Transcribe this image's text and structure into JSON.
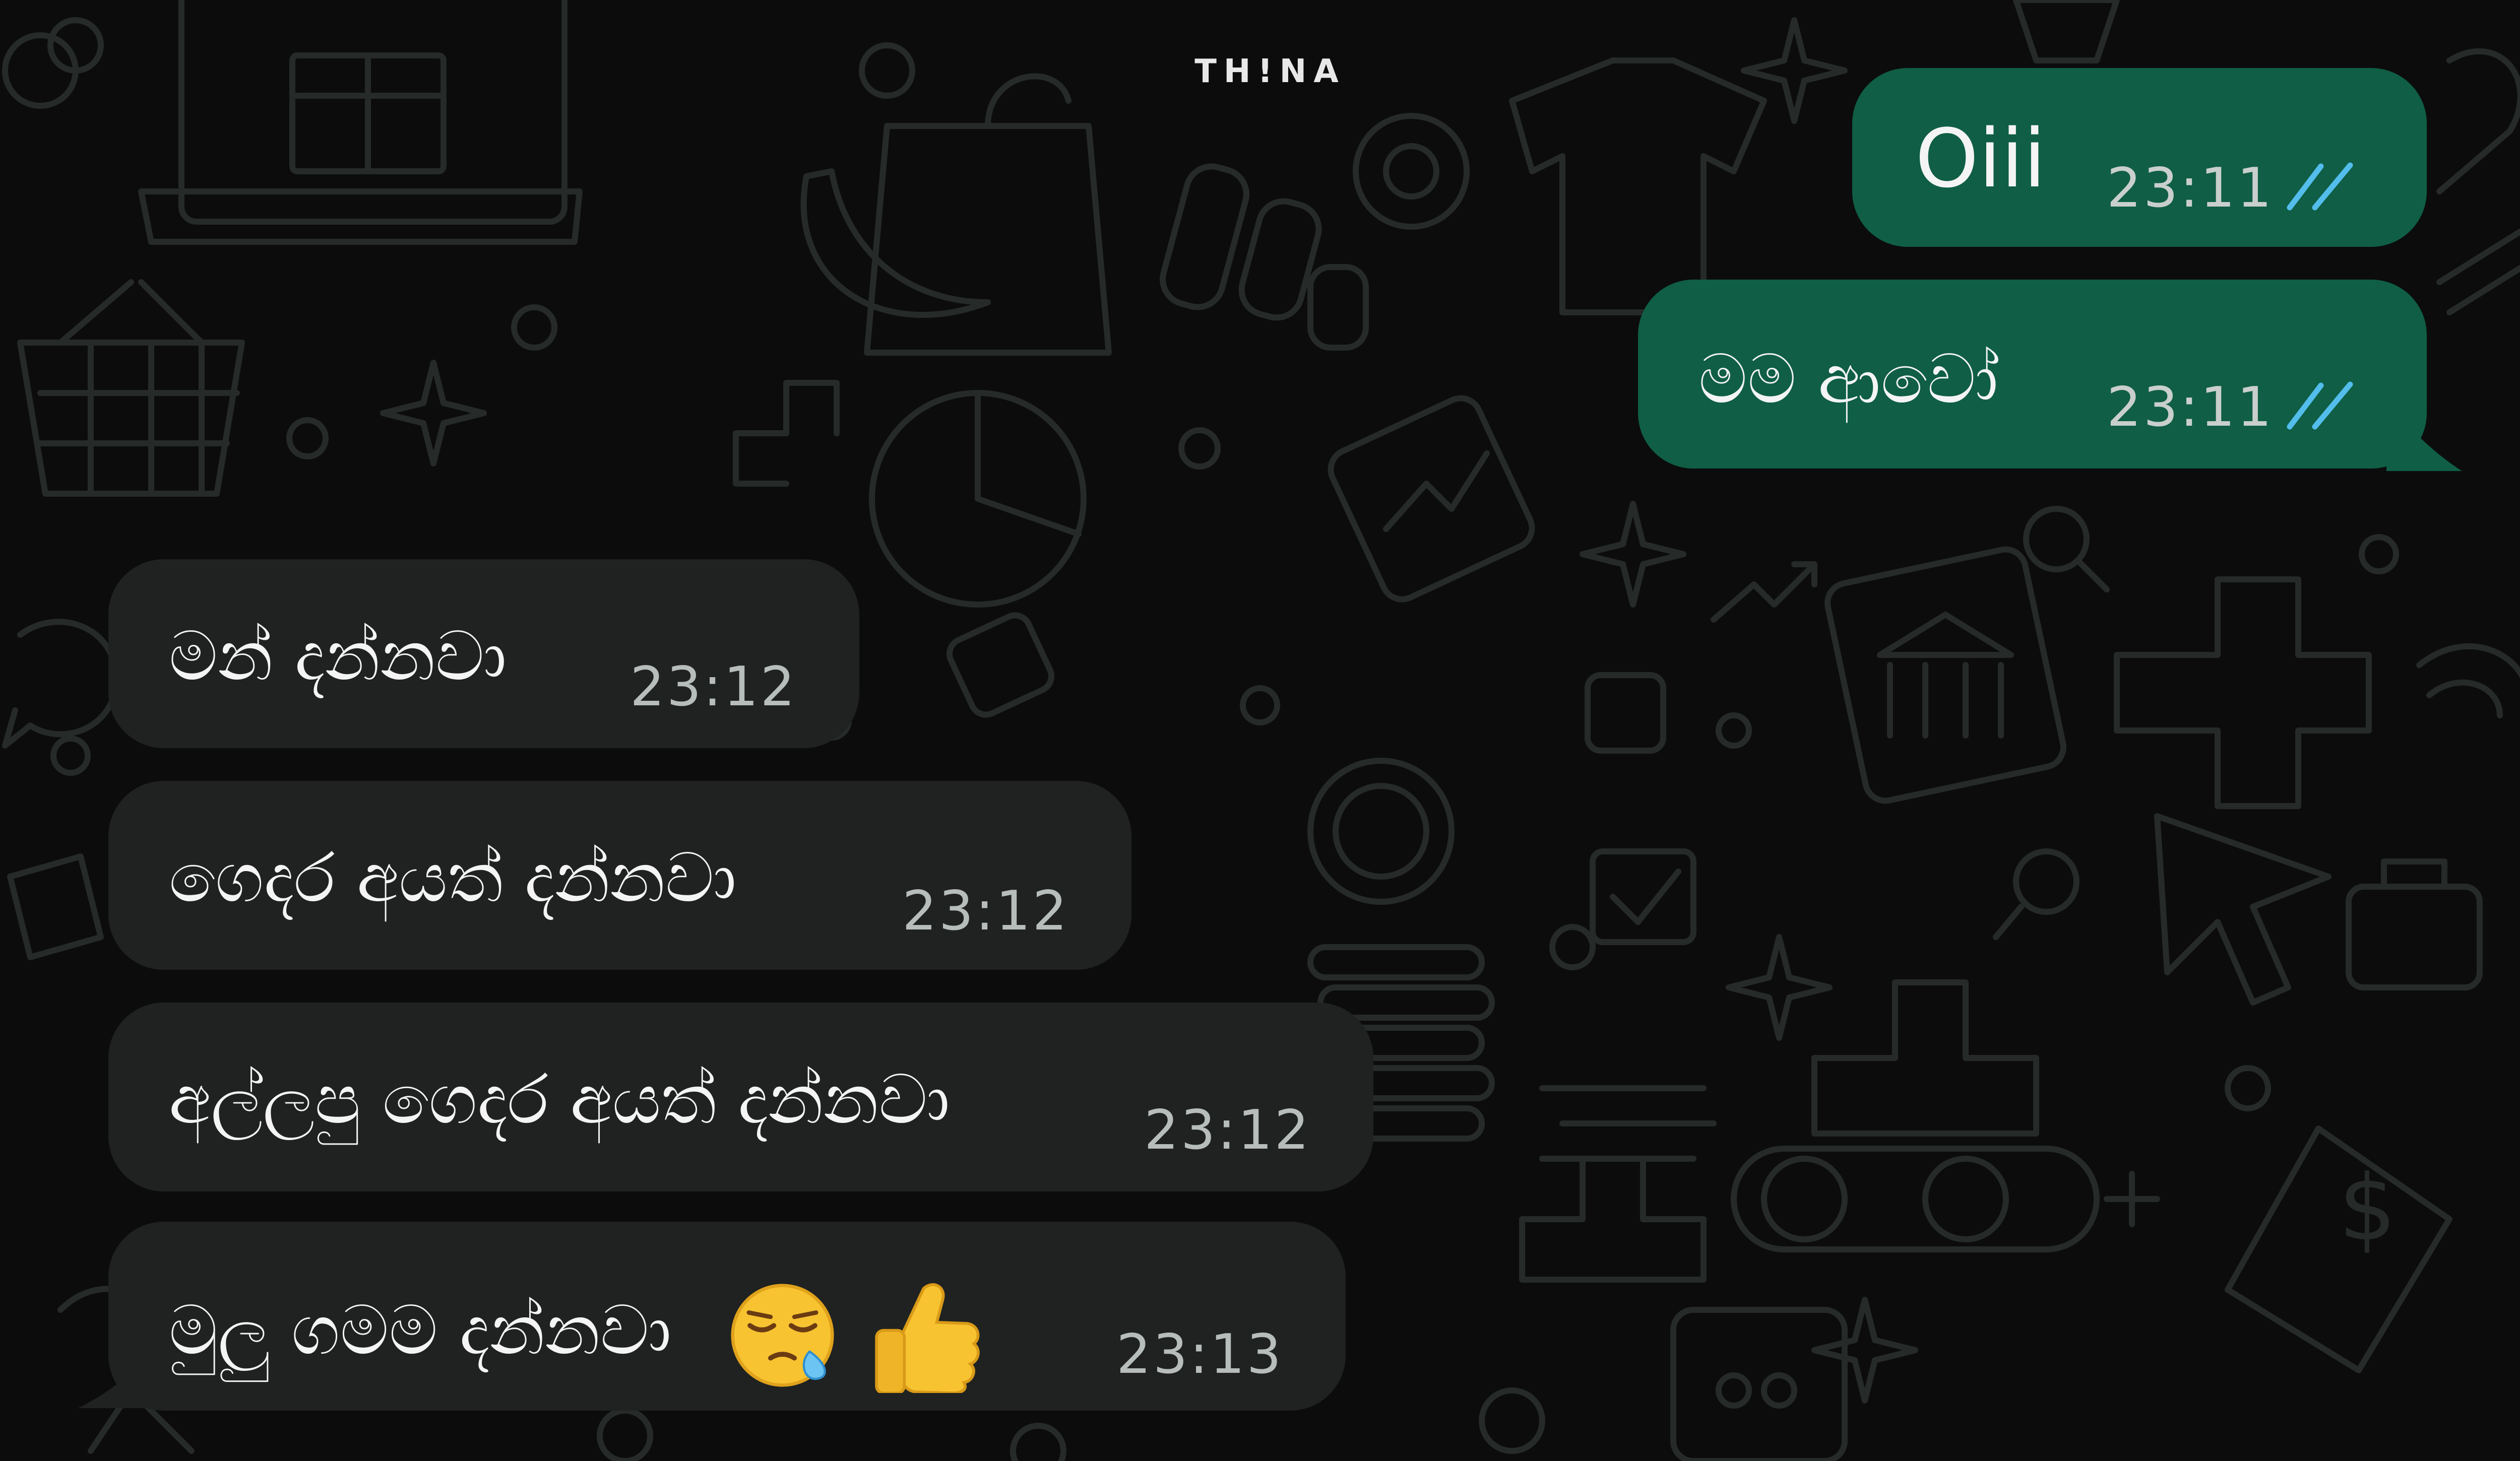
{
  "watermark": "TH!NA",
  "colors": {
    "background": "#0c0c0c",
    "doodle_stroke": "#262a29",
    "outgoing_bubble": "#0f5e45",
    "incoming_bubble": "#1f2221",
    "read_tick": "#53bdeb"
  },
  "messages": [
    {
      "direction": "outgoing",
      "text": "Oiii",
      "time": "23:11",
      "status": "read"
    },
    {
      "direction": "outgoing",
      "text": "මම ආවෝ",
      "time": "23:11",
      "status": "read"
    },
    {
      "direction": "incoming",
      "text": "මන් දන්නවා",
      "time": "23:12"
    },
    {
      "direction": "incoming",
      "text": "ගෙදර අයත් දන්නවා",
      "time": "23:12"
    },
    {
      "direction": "incoming",
      "text": "අල්ලපු ගෙදර අයත් දන්නවා",
      "time": "23:12"
    },
    {
      "direction": "incoming",
      "text": "මුලු ගමම දන්නවා",
      "time": "23:13",
      "emojis": [
        "sleepy-face",
        "thumbs-up"
      ]
    }
  ]
}
